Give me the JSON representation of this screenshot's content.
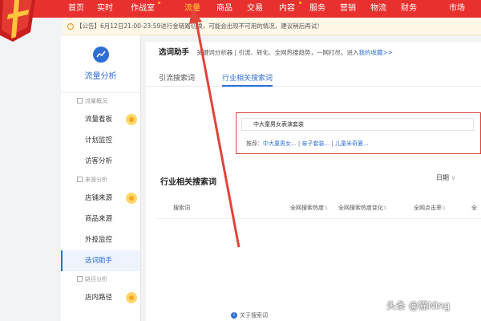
{
  "nav": {
    "items": [
      "首页",
      "实时",
      "作战室",
      "流量",
      "商品",
      "交易",
      "内容",
      "服务",
      "营销",
      "物流",
      "财务",
      "市场"
    ],
    "active": "流量"
  },
  "notice": {
    "text": "【公告】6月12日21:00-23:59进行金链路切换，可能会出现不可用的情况，建议稍后再试！"
  },
  "sidebar": {
    "title": "流量分析",
    "groups": [
      {
        "label": "流量概况",
        "items": [
          "流量看板",
          "计划监控",
          "访客分析"
        ]
      },
      {
        "label": "来源分析",
        "items": [
          "店铺来源",
          "商品来源",
          "外投监控",
          "选词助手"
        ]
      },
      {
        "label": "路径分析",
        "items": [
          "店内路径"
        ]
      }
    ],
    "active_item": "选词助手"
  },
  "tool": {
    "title": "选词助手",
    "desc": "关键词分析器 | 引流、转化、全网热搜趋势，一网打尽。进入",
    "link": "我的收藏>>"
  },
  "tabs": [
    "引流搜索词",
    "行业相关搜索词"
  ],
  "search": {
    "value": "中大童男女表演套装",
    "recommend_label": "推荐：",
    "recommend_items": [
      "中大童男女...",
      "亲子套装...",
      "儿童米奇夏..."
    ]
  },
  "section": {
    "title": "行业相关搜索词",
    "date_label": "日期"
  },
  "table": {
    "headers": [
      "搜索词",
      "全网搜索热度",
      "全网搜索热度变化",
      "全网点击率",
      "全"
    ]
  },
  "info": {
    "text": "关于搜索词"
  },
  "watermark": "头条 @猫Ning",
  "colors": {
    "nav_bg": "#e8312f",
    "accent": "#2f6fd6",
    "arrow": "#e0443a"
  }
}
